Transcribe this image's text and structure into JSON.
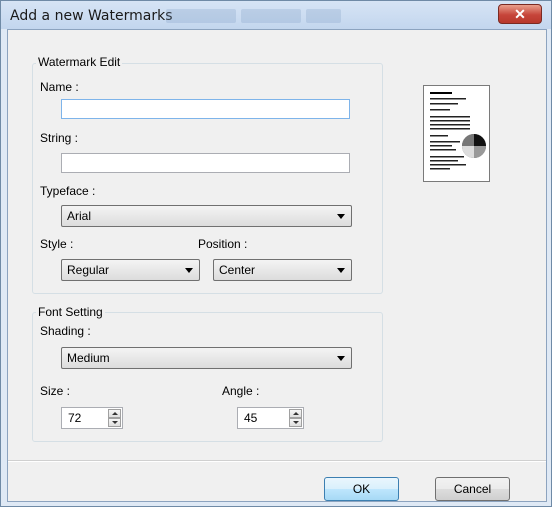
{
  "window": {
    "title": "Add a new Watermarks",
    "close_glyph": "✕",
    "close_icon": "close-icon"
  },
  "watermark_edit": {
    "legend": "Watermark Edit",
    "name_label": "Name :",
    "name_value": "",
    "string_label": "String :",
    "string_value": "",
    "typeface_label": "Typeface :",
    "typeface_value": "Arial",
    "style_label": "Style :",
    "style_value": "Regular",
    "position_label": "Position :",
    "position_value": "Center"
  },
  "font_setting": {
    "legend": "Font Setting",
    "shading_label": "Shading :",
    "shading_value": "Medium",
    "size_label": "Size :",
    "size_value": "72",
    "angle_label": "Angle :",
    "angle_value": "45"
  },
  "buttons": {
    "ok": "OK",
    "cancel": "Cancel"
  },
  "icons": {
    "dropdown": "chevron-down-icon",
    "spin_up": "spin-up-icon",
    "spin_down": "spin-down-icon",
    "preview": "watermark-preview-icon"
  }
}
